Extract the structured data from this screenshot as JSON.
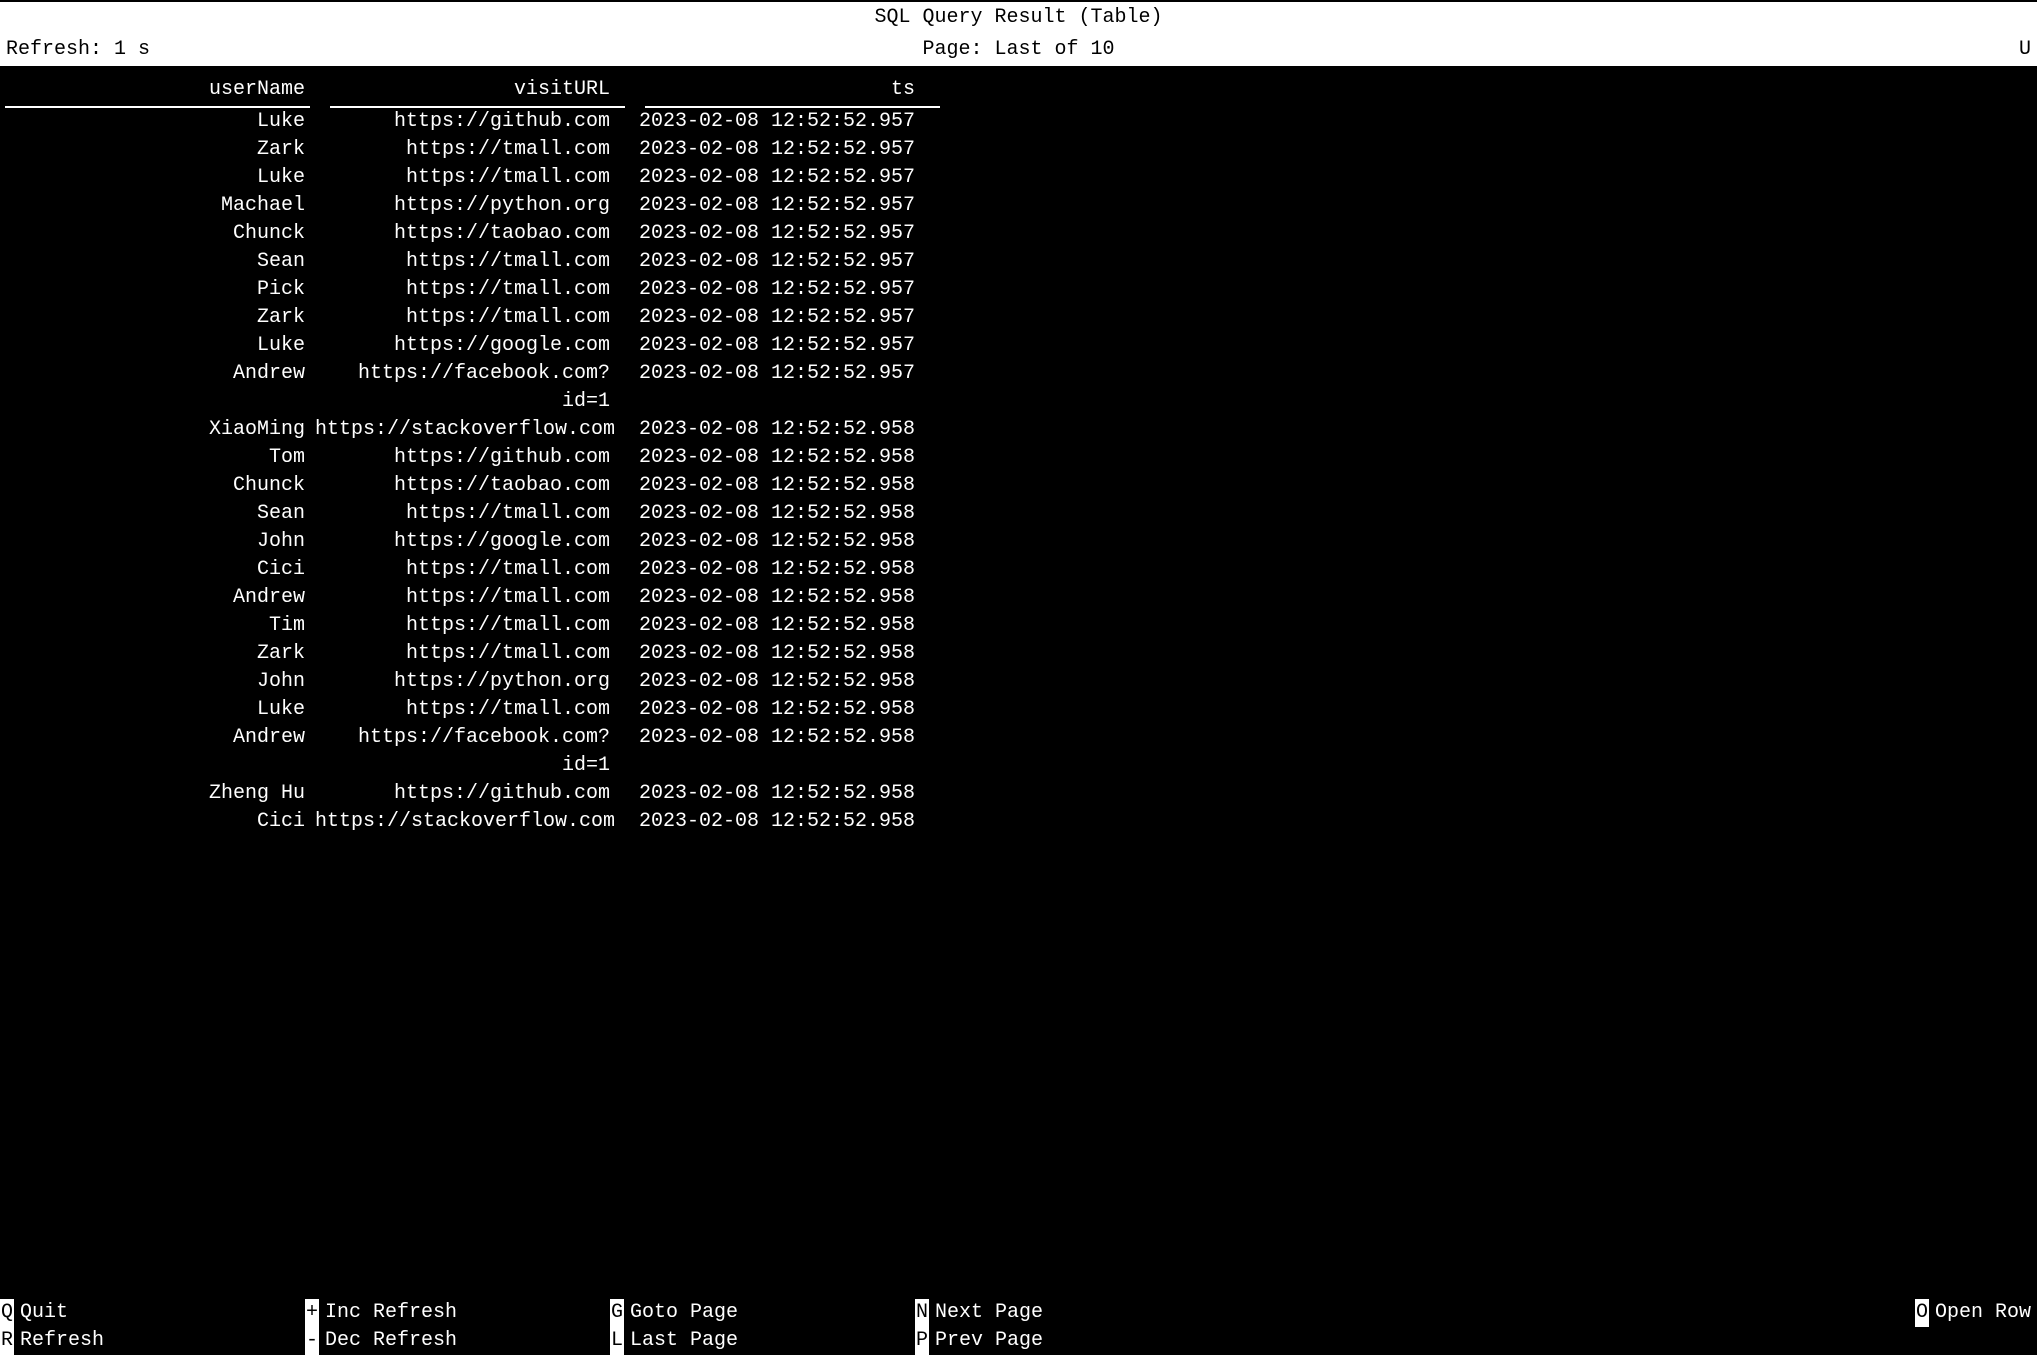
{
  "header": {
    "title": "SQL Query Result (Table)",
    "refresh_label": "Refresh: 1 s",
    "page_label": "Page: Last of 10",
    "right_char": "U"
  },
  "columns": {
    "userName": "userName",
    "visitURL": "visitURL",
    "ts": "ts"
  },
  "rows": [
    {
      "userName": "Luke",
      "visitURL": "https://github.com",
      "ts": "2023-02-08 12:52:52.957"
    },
    {
      "userName": "Zark",
      "visitURL": "https://tmall.com",
      "ts": "2023-02-08 12:52:52.957"
    },
    {
      "userName": "Luke",
      "visitURL": "https://tmall.com",
      "ts": "2023-02-08 12:52:52.957"
    },
    {
      "userName": "Machael",
      "visitURL": "https://python.org",
      "ts": "2023-02-08 12:52:52.957"
    },
    {
      "userName": "Chunck",
      "visitURL": "https://taobao.com",
      "ts": "2023-02-08 12:52:52.957"
    },
    {
      "userName": "Sean",
      "visitURL": "https://tmall.com",
      "ts": "2023-02-08 12:52:52.957"
    },
    {
      "userName": "Pick",
      "visitURL": "https://tmall.com",
      "ts": "2023-02-08 12:52:52.957"
    },
    {
      "userName": "Zark",
      "visitURL": "https://tmall.com",
      "ts": "2023-02-08 12:52:52.957"
    },
    {
      "userName": "Luke",
      "visitURL": "https://google.com",
      "ts": "2023-02-08 12:52:52.957"
    },
    {
      "userName": "Andrew",
      "visitURL": "https://facebook.com?id=1",
      "ts": "2023-02-08 12:52:52.957"
    },
    {
      "userName": "XiaoMing",
      "visitURL": "https://stackoverflow.com",
      "ts": "2023-02-08 12:52:52.958"
    },
    {
      "userName": "Tom",
      "visitURL": "https://github.com",
      "ts": "2023-02-08 12:52:52.958"
    },
    {
      "userName": "Chunck",
      "visitURL": "https://taobao.com",
      "ts": "2023-02-08 12:52:52.958"
    },
    {
      "userName": "Sean",
      "visitURL": "https://tmall.com",
      "ts": "2023-02-08 12:52:52.958"
    },
    {
      "userName": "John",
      "visitURL": "https://google.com",
      "ts": "2023-02-08 12:52:52.958"
    },
    {
      "userName": "Cici",
      "visitURL": "https://tmall.com",
      "ts": "2023-02-08 12:52:52.958"
    },
    {
      "userName": "Andrew",
      "visitURL": "https://tmall.com",
      "ts": "2023-02-08 12:52:52.958"
    },
    {
      "userName": "Tim",
      "visitURL": "https://tmall.com",
      "ts": "2023-02-08 12:52:52.958"
    },
    {
      "userName": "Zark",
      "visitURL": "https://tmall.com",
      "ts": "2023-02-08 12:52:52.958"
    },
    {
      "userName": "John",
      "visitURL": "https://python.org",
      "ts": "2023-02-08 12:52:52.958"
    },
    {
      "userName": "Luke",
      "visitURL": "https://tmall.com",
      "ts": "2023-02-08 12:52:52.958"
    },
    {
      "userName": "Andrew",
      "visitURL": "https://facebook.com?id=1",
      "ts": "2023-02-08 12:52:52.958"
    },
    {
      "userName": "Zheng Hu",
      "visitURL": "https://github.com",
      "ts": "2023-02-08 12:52:52.958"
    },
    {
      "userName": "Cici",
      "visitURL": "https://stackoverflow.com",
      "ts": "2023-02-08 12:52:52.958"
    }
  ],
  "footer": {
    "row1": [
      {
        "key": "Q",
        "label": "Quit"
      },
      {
        "key": "+",
        "label": "Inc Refresh"
      },
      {
        "key": "G",
        "label": "Goto Page"
      },
      {
        "key": "N",
        "label": "Next Page"
      },
      {
        "key": "O",
        "label": "Open Row"
      }
    ],
    "row2": [
      {
        "key": "R",
        "label": "Refresh"
      },
      {
        "key": "-",
        "label": "Dec Refresh"
      },
      {
        "key": "L",
        "label": "Last Page"
      },
      {
        "key": "P",
        "label": "Prev Page"
      }
    ]
  }
}
